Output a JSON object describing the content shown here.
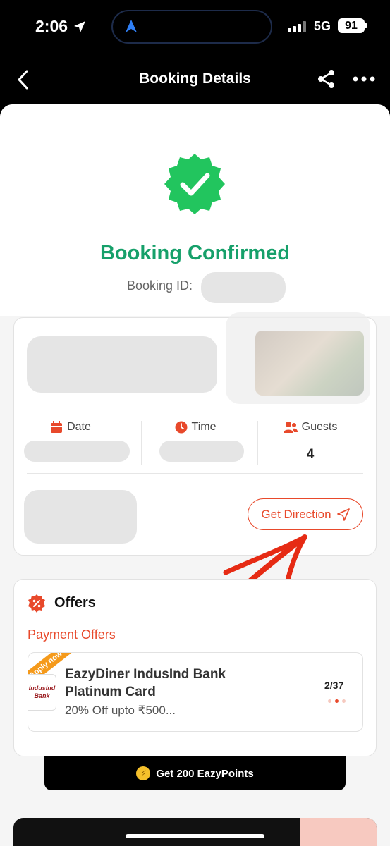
{
  "status_bar": {
    "time": "2:06",
    "network": "5G",
    "battery": "91"
  },
  "nav": {
    "title": "Booking Details"
  },
  "confirmation": {
    "title": "Booking Confirmed",
    "booking_id_label": "Booking ID:"
  },
  "booking_card": {
    "date_label": "Date",
    "time_label": "Time",
    "guests_label": "Guests",
    "guests_value": "4",
    "direction_button": "Get Direction"
  },
  "offers": {
    "title": "Offers",
    "section_label": "Payment Offers",
    "ribbon": "Apply now",
    "bank_logo": "IndusInd Bank",
    "offer_title": "EazyDiner IndusInd Bank Platinum Card",
    "offer_subtitle": "20% Off upto ₹500...",
    "counter": "2/37"
  },
  "points": {
    "label": "Get 200 EazyPoints"
  },
  "colors": {
    "accent": "#e8492b",
    "success": "#16a06a",
    "coin": "#f5c02b"
  }
}
